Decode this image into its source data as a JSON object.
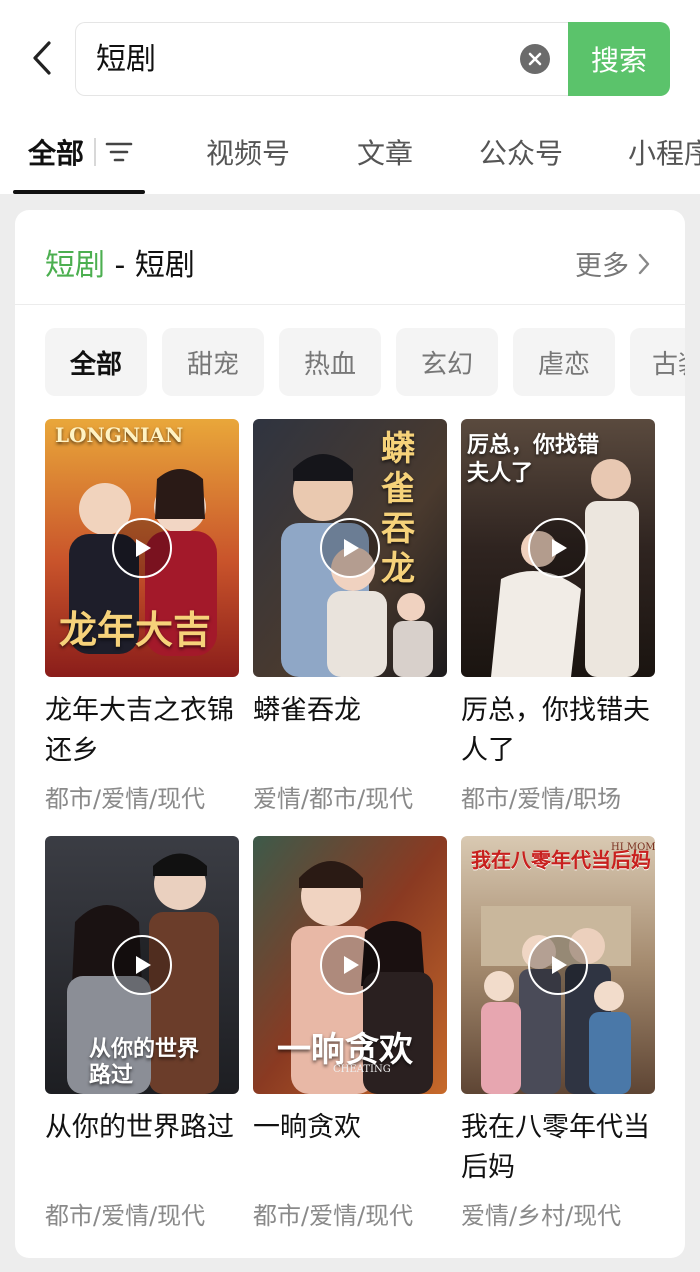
{
  "search": {
    "query": "短剧",
    "button_label": "搜索"
  },
  "tabs": [
    {
      "label": "全部"
    },
    {
      "label": "视频号"
    },
    {
      "label": "文章"
    },
    {
      "label": "公众号"
    },
    {
      "label": "小程序"
    }
  ],
  "card": {
    "title_keyword": "短剧",
    "title_rest": " - 短剧",
    "more_label": "更多"
  },
  "chips": [
    {
      "label": "全部"
    },
    {
      "label": "甜宠"
    },
    {
      "label": "热血"
    },
    {
      "label": "玄幻"
    },
    {
      "label": "虐恋"
    },
    {
      "label": "古装"
    }
  ],
  "dramas": [
    {
      "title": "龙年大吉之衣锦还乡",
      "tags": "都市/爱情/现代",
      "poster_text": "龙年大吉",
      "poster_top": "LONGNIAN"
    },
    {
      "title": "蟒雀吞龙",
      "tags": "爱情/都市/现代",
      "poster_text": "蟒雀吞龙"
    },
    {
      "title": "厉总，你找错夫人了",
      "tags": "都市/爱情/职场",
      "poster_text": "厉总，你找错夫人了"
    },
    {
      "title": "从你的世界路过",
      "tags": "都市/爱情/现代",
      "poster_text": "从你的世界路过"
    },
    {
      "title": "一晌贪欢",
      "tags": "都市/爱情/现代",
      "poster_text": "一晌贪欢",
      "poster_sub": "CHEATING"
    },
    {
      "title": "我在八零年代当后妈",
      "tags": "爱情/乡村/现代",
      "poster_text": "我在八零年代当后妈",
      "poster_sub": "HI MOM"
    }
  ],
  "colors": {
    "accent": "#5bc36b",
    "keyword": "#4caf50",
    "background": "#ededed"
  },
  "icons": [
    "back-arrow-icon",
    "clear-icon",
    "filter-icon",
    "chevron-right-icon",
    "play-icon"
  ]
}
